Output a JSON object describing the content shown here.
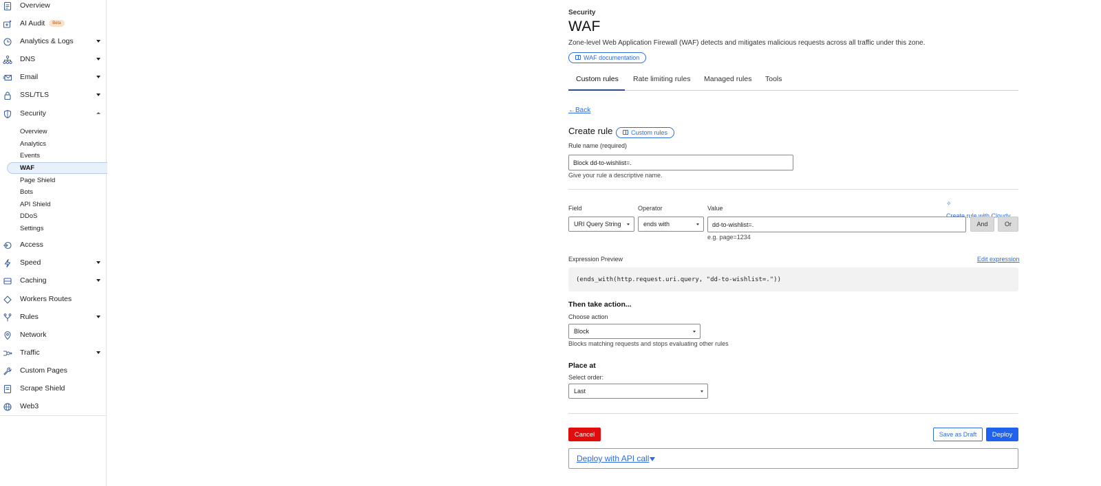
{
  "sidebar": {
    "items": [
      {
        "label": "Overview",
        "icon": "document-icon"
      },
      {
        "label": "AI Audit",
        "icon": "ai-audit-icon",
        "badge": "Beta"
      },
      {
        "label": "Analytics & Logs",
        "icon": "clock-chart-icon",
        "expandable": true
      },
      {
        "label": "DNS",
        "icon": "dns-tree-icon",
        "expandable": true
      },
      {
        "label": "Email",
        "icon": "envelope-icon",
        "expandable": true
      },
      {
        "label": "SSL/TLS",
        "icon": "lock-icon",
        "expandable": true
      },
      {
        "label": "Security",
        "icon": "shield-icon",
        "expanded": true
      },
      {
        "label": "Access",
        "icon": "access-icon"
      },
      {
        "label": "Speed",
        "icon": "lightning-icon",
        "expandable": true
      },
      {
        "label": "Caching",
        "icon": "cache-icon",
        "expandable": true
      },
      {
        "label": "Workers Routes",
        "icon": "workers-icon"
      },
      {
        "label": "Rules",
        "icon": "rules-fork-icon",
        "expandable": true
      },
      {
        "label": "Network",
        "icon": "location-pin-icon"
      },
      {
        "label": "Traffic",
        "icon": "traffic-icon",
        "expandable": true
      },
      {
        "label": "Custom Pages",
        "icon": "wrench-icon"
      },
      {
        "label": "Scrape Shield",
        "icon": "scrape-shield-icon"
      },
      {
        "label": "Web3",
        "icon": "globe-icon"
      }
    ],
    "security_sub": [
      {
        "label": "Overview"
      },
      {
        "label": "Analytics"
      },
      {
        "label": "Events"
      },
      {
        "label": "WAF",
        "active": true
      },
      {
        "label": "Page Shield"
      },
      {
        "label": "Bots"
      },
      {
        "label": "API Shield"
      },
      {
        "label": "DDoS"
      },
      {
        "label": "Settings"
      }
    ]
  },
  "header": {
    "breadcrumb": "Security",
    "title": "WAF",
    "description": "Zone-level Web Application Firewall (WAF) detects and mitigates malicious requests across all traffic under this zone.",
    "doc_link": "WAF documentation"
  },
  "tabs": [
    {
      "label": "Custom rules",
      "active": true
    },
    {
      "label": "Rate limiting rules"
    },
    {
      "label": "Managed rules"
    },
    {
      "label": "Tools"
    }
  ],
  "form": {
    "back": "Back",
    "heading": "Create rule",
    "heading_link": "Custom rules",
    "rule_name_label": "Rule name (required)",
    "rule_name_value": "Block dd-to-wishlist=.",
    "rule_name_help": "Give your rule a descriptive name.",
    "cloudy_link": "Create rule with Cloudy",
    "field_label": "Field",
    "field_value": "URI Query String",
    "operator_label": "Operator",
    "operator_value": "ends with",
    "value_label": "Value",
    "value_value": "dd-to-wishlist=.",
    "value_help": "e.g. page=1234",
    "and_label": "And",
    "or_label": "Or",
    "expression_label": "Expression Preview",
    "edit_expression": "Edit expression",
    "expression": "(ends_with(http.request.uri.query, \"dd-to-wishlist=.\"))",
    "action_heading": "Then take action...",
    "action_label": "Choose action",
    "action_value": "Block",
    "action_help": "Blocks matching requests and stops evaluating other rules",
    "place_heading": "Place at",
    "order_label": "Select order:",
    "order_value": "Last",
    "cancel": "Cancel",
    "save_draft": "Save as Draft",
    "deploy": "Deploy",
    "api_call": "Deploy with API call"
  },
  "colors": {
    "accent": "#2d6ce0",
    "deploy": "#1e62ee",
    "cancel": "#e10d0d"
  }
}
